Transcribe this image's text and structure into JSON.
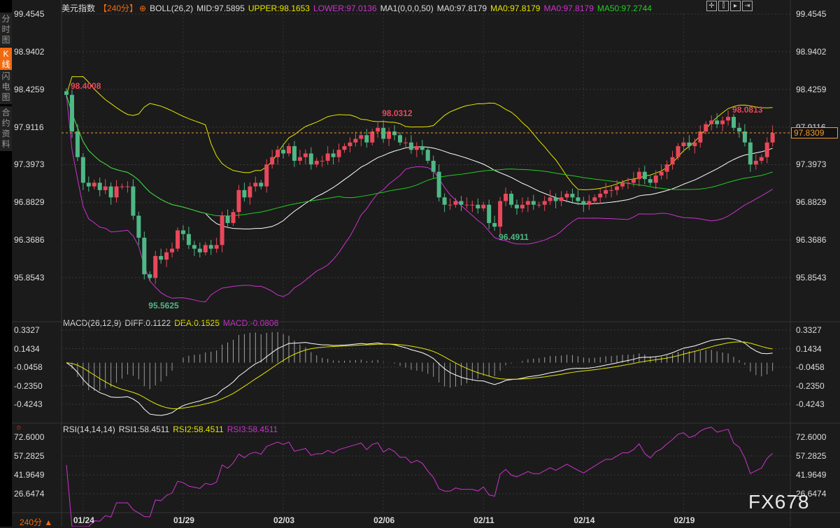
{
  "sidebar": {
    "tabs": [
      {
        "label": "分时图",
        "active": false
      },
      {
        "label": "K线图",
        "active": true
      },
      {
        "label": "闪电图",
        "active": false
      },
      {
        "label": "合约资料",
        "active": false
      }
    ]
  },
  "header": {
    "symbol": "美元指数",
    "period": "【240分】",
    "boll": "BOLL(26,2)",
    "mid": "MID:97.5895",
    "upper": "UPPER:98.1653",
    "lower": "LOWER:97.0136",
    "ma": "MA1(0,0,0,50)",
    "ma0a": "MA0:97.8179",
    "ma0b": "MA0:97.8179",
    "ma0c": "MA0:97.8179",
    "ma50": "MA50:97.2744"
  },
  "toolbar": {
    "icons": [
      "crosshair-icon",
      "zoom-start-icon",
      "play-icon",
      "end-icon"
    ]
  },
  "macd_header": {
    "name": "MACD(26,12,9)",
    "diff": "DIFF:0.1122",
    "dea": "DEA:0.1525",
    "macd": "MACD:-0.0806"
  },
  "rsi_header": {
    "name": "RSI(14,14,14)",
    "rsi1": "RSI1:58.4511",
    "rsi2": "RSI2:58.4511",
    "rsi3": "RSI3:58.4511"
  },
  "period_label": "240分 ▲",
  "watermark": "FX678",
  "current_price": "97.8309",
  "colors": {
    "up": "#e9485a",
    "down": "#4fb886",
    "mid": "#ffffff",
    "upper": "#e6e600",
    "lower": "#cc33cc",
    "ma50": "#22cc22",
    "accent": "#f26a10"
  },
  "chart_data": {
    "type": "candlestick",
    "price_ticks": [
      "99.4545",
      "98.9402",
      "98.4259",
      "97.9116",
      "97.3973",
      "96.8829",
      "96.3686",
      "95.8543"
    ],
    "macd_ticks": [
      "0.3327",
      "0.1434",
      "-0.0458",
      "-0.2350",
      "-0.4243"
    ],
    "rsi_ticks": [
      "72.6000",
      "57.2825",
      "41.9649",
      "26.6474"
    ],
    "x_labels": [
      "01/24",
      "01/29",
      "02/03",
      "02/06",
      "02/11",
      "02/14",
      "02/19"
    ],
    "x_label_index": [
      3,
      21,
      39,
      57,
      75,
      93,
      111
    ],
    "closes": [
      98.35,
      97.85,
      97.5,
      97.15,
      97.1,
      97.15,
      97.05,
      97.1,
      96.95,
      97.1,
      97.1,
      97.1,
      96.7,
      96.4,
      95.9,
      95.85,
      96.15,
      96.1,
      96.2,
      96.25,
      96.5,
      96.45,
      96.3,
      96.25,
      96.2,
      96.3,
      96.25,
      96.3,
      96.7,
      96.6,
      96.75,
      97.05,
      96.95,
      97.1,
      97.15,
      97.1,
      97.4,
      97.5,
      97.6,
      97.55,
      97.65,
      97.45,
      97.5,
      97.55,
      97.4,
      97.45,
      97.45,
      97.55,
      97.5,
      97.6,
      97.65,
      97.7,
      97.75,
      97.8,
      97.7,
      97.85,
      97.9,
      97.75,
      97.85,
      97.8,
      97.7,
      97.7,
      97.6,
      97.65,
      97.6,
      97.45,
      97.3,
      96.95,
      96.85,
      96.85,
      96.9,
      96.85,
      96.85,
      96.85,
      96.8,
      96.85,
      96.6,
      96.55,
      96.9,
      97.0,
      96.85,
      96.8,
      96.85,
      96.9,
      96.85,
      96.85,
      96.9,
      96.95,
      96.9,
      96.95,
      97.0,
      96.95,
      96.9,
      96.85,
      96.9,
      96.95,
      97.0,
      97.05,
      97.05,
      97.1,
      97.15,
      97.15,
      97.2,
      97.3,
      97.2,
      97.15,
      97.25,
      97.3,
      97.4,
      97.5,
      97.65,
      97.7,
      97.65,
      97.7,
      97.85,
      97.95,
      98.0,
      97.95,
      98.0,
      98.05,
      97.9,
      97.85,
      97.7,
      97.4,
      97.45,
      97.5,
      97.7,
      97.8309
    ],
    "annotations": [
      {
        "label": "98.4008",
        "index": 0,
        "kind": "high"
      },
      {
        "label": "95.5625",
        "index": 14,
        "kind": "low"
      },
      {
        "label": "98.0312",
        "index": 56,
        "kind": "high"
      },
      {
        "label": "96.4911",
        "index": 77,
        "kind": "low"
      },
      {
        "label": "98.0813",
        "index": 119,
        "kind": "high"
      }
    ]
  }
}
